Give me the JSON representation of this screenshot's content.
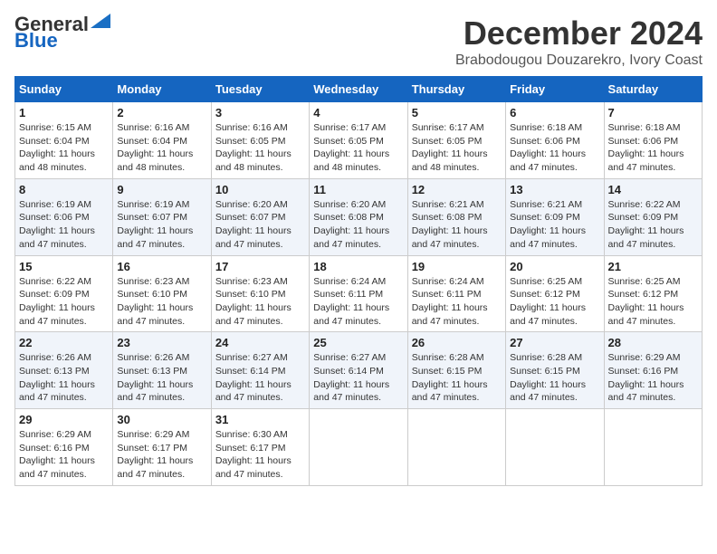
{
  "header": {
    "logo_line1": "General",
    "logo_line2": "Blue",
    "month": "December 2024",
    "location": "Brabodougou Douzarekro, Ivory Coast"
  },
  "weekdays": [
    "Sunday",
    "Monday",
    "Tuesday",
    "Wednesday",
    "Thursday",
    "Friday",
    "Saturday"
  ],
  "weeks": [
    [
      {
        "day": "1",
        "sunrise": "6:15 AM",
        "sunset": "6:04 PM",
        "daylight": "11 hours and 48 minutes."
      },
      {
        "day": "2",
        "sunrise": "6:16 AM",
        "sunset": "6:04 PM",
        "daylight": "11 hours and 48 minutes."
      },
      {
        "day": "3",
        "sunrise": "6:16 AM",
        "sunset": "6:05 PM",
        "daylight": "11 hours and 48 minutes."
      },
      {
        "day": "4",
        "sunrise": "6:17 AM",
        "sunset": "6:05 PM",
        "daylight": "11 hours and 48 minutes."
      },
      {
        "day": "5",
        "sunrise": "6:17 AM",
        "sunset": "6:05 PM",
        "daylight": "11 hours and 48 minutes."
      },
      {
        "day": "6",
        "sunrise": "6:18 AM",
        "sunset": "6:06 PM",
        "daylight": "11 hours and 47 minutes."
      },
      {
        "day": "7",
        "sunrise": "6:18 AM",
        "sunset": "6:06 PM",
        "daylight": "11 hours and 47 minutes."
      }
    ],
    [
      {
        "day": "8",
        "sunrise": "6:19 AM",
        "sunset": "6:06 PM",
        "daylight": "11 hours and 47 minutes."
      },
      {
        "day": "9",
        "sunrise": "6:19 AM",
        "sunset": "6:07 PM",
        "daylight": "11 hours and 47 minutes."
      },
      {
        "day": "10",
        "sunrise": "6:20 AM",
        "sunset": "6:07 PM",
        "daylight": "11 hours and 47 minutes."
      },
      {
        "day": "11",
        "sunrise": "6:20 AM",
        "sunset": "6:08 PM",
        "daylight": "11 hours and 47 minutes."
      },
      {
        "day": "12",
        "sunrise": "6:21 AM",
        "sunset": "6:08 PM",
        "daylight": "11 hours and 47 minutes."
      },
      {
        "day": "13",
        "sunrise": "6:21 AM",
        "sunset": "6:09 PM",
        "daylight": "11 hours and 47 minutes."
      },
      {
        "day": "14",
        "sunrise": "6:22 AM",
        "sunset": "6:09 PM",
        "daylight": "11 hours and 47 minutes."
      }
    ],
    [
      {
        "day": "15",
        "sunrise": "6:22 AM",
        "sunset": "6:09 PM",
        "daylight": "11 hours and 47 minutes."
      },
      {
        "day": "16",
        "sunrise": "6:23 AM",
        "sunset": "6:10 PM",
        "daylight": "11 hours and 47 minutes."
      },
      {
        "day": "17",
        "sunrise": "6:23 AM",
        "sunset": "6:10 PM",
        "daylight": "11 hours and 47 minutes."
      },
      {
        "day": "18",
        "sunrise": "6:24 AM",
        "sunset": "6:11 PM",
        "daylight": "11 hours and 47 minutes."
      },
      {
        "day": "19",
        "sunrise": "6:24 AM",
        "sunset": "6:11 PM",
        "daylight": "11 hours and 47 minutes."
      },
      {
        "day": "20",
        "sunrise": "6:25 AM",
        "sunset": "6:12 PM",
        "daylight": "11 hours and 47 minutes."
      },
      {
        "day": "21",
        "sunrise": "6:25 AM",
        "sunset": "6:12 PM",
        "daylight": "11 hours and 47 minutes."
      }
    ],
    [
      {
        "day": "22",
        "sunrise": "6:26 AM",
        "sunset": "6:13 PM",
        "daylight": "11 hours and 47 minutes."
      },
      {
        "day": "23",
        "sunrise": "6:26 AM",
        "sunset": "6:13 PM",
        "daylight": "11 hours and 47 minutes."
      },
      {
        "day": "24",
        "sunrise": "6:27 AM",
        "sunset": "6:14 PM",
        "daylight": "11 hours and 47 minutes."
      },
      {
        "day": "25",
        "sunrise": "6:27 AM",
        "sunset": "6:14 PM",
        "daylight": "11 hours and 47 minutes."
      },
      {
        "day": "26",
        "sunrise": "6:28 AM",
        "sunset": "6:15 PM",
        "daylight": "11 hours and 47 minutes."
      },
      {
        "day": "27",
        "sunrise": "6:28 AM",
        "sunset": "6:15 PM",
        "daylight": "11 hours and 47 minutes."
      },
      {
        "day": "28",
        "sunrise": "6:29 AM",
        "sunset": "6:16 PM",
        "daylight": "11 hours and 47 minutes."
      }
    ],
    [
      {
        "day": "29",
        "sunrise": "6:29 AM",
        "sunset": "6:16 PM",
        "daylight": "11 hours and 47 minutes."
      },
      {
        "day": "30",
        "sunrise": "6:29 AM",
        "sunset": "6:17 PM",
        "daylight": "11 hours and 47 minutes."
      },
      {
        "day": "31",
        "sunrise": "6:30 AM",
        "sunset": "6:17 PM",
        "daylight": "11 hours and 47 minutes."
      },
      null,
      null,
      null,
      null
    ]
  ]
}
